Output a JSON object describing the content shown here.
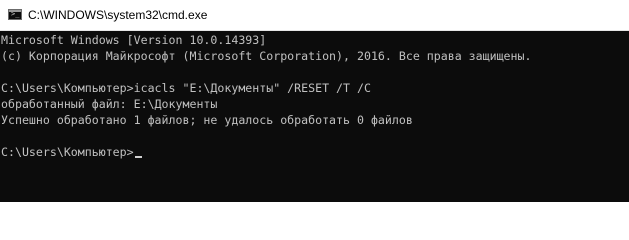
{
  "window": {
    "title": "C:\\WINDOWS\\system32\\cmd.exe",
    "icon": "cmd-icon"
  },
  "console": {
    "lines": [
      "Microsoft Windows [Version 10.0.14393]",
      "(c) Корпорация Майкрософт (Microsoft Corporation), 2016. Все права защищены.",
      "",
      "C:\\Users\\Компьютер>icacls \"E:\\Документы\" /RESET /T /C",
      "обработанный файл: E:\\Документы",
      "Успешно обработано 1 файлов; не удалось обработать 0 файлов",
      "",
      "C:\\Users\\Компьютер>"
    ]
  }
}
